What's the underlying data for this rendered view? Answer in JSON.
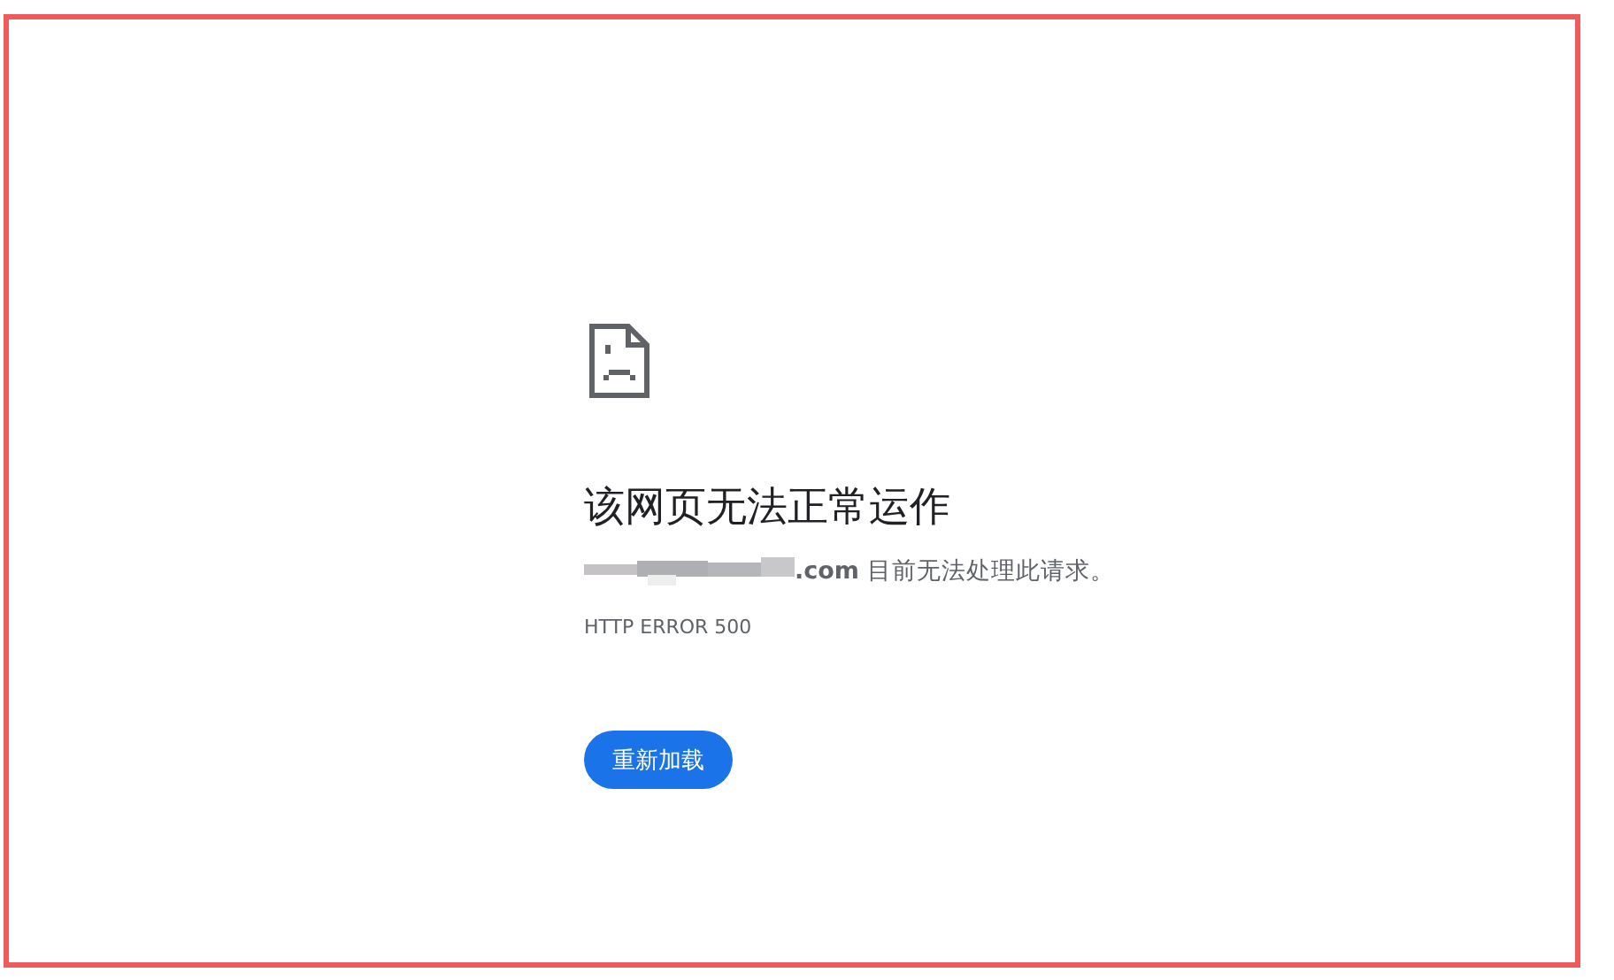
{
  "error": {
    "title": "该网页无法正常运作",
    "message": "**.com** 目前无法处理此请求。",
    "code": "HTTP ERROR 500",
    "button": "重新加载"
  }
}
